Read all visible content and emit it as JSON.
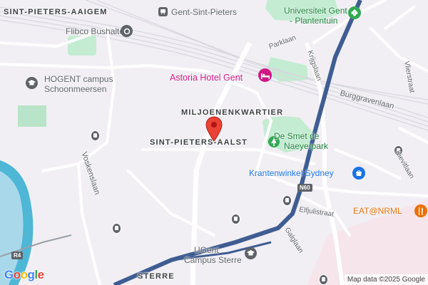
{
  "districts": {
    "sint_pieters_aaigem": "SINT-PIETERS-AAIGEM",
    "miljoenenkwartier": "MILJOENENKWARTIER",
    "sint_pieters_aalst": "SINT-PIETERS-AALST",
    "sterre": "STERRE"
  },
  "pois": {
    "gent_sint_pieters": "Gent-Sint-Pieters",
    "universiteit_line1": "Universiteit Gent",
    "universiteit_line2": "- Plantentuin",
    "flibco": "Flibco Bushalte",
    "hogent_line1": "HOGENT campus",
    "hogent_line2": "Schoonmeersen",
    "astoria": "Astoria Hotel Gent",
    "desmet_line1": "De Smet de",
    "desmet_line2": "Naeyerpark",
    "krantenwinkel": "Krantenwinkel Sydney",
    "eat": "EAT@NRML",
    "ugent_line1": "UGent",
    "ugent_line2": "Campus Sterre"
  },
  "roads": {
    "parklaan": "Parklaan",
    "krijgslaan": "Krijgslaan",
    "burggravenlaan": "Burggravenlaan",
    "vlierstraat": "Vlierstraat",
    "voskenslaan": "Voskenslaan",
    "kievitlaan": "Kievitlaan",
    "elfjulistraat": "Elfjulistraat",
    "galglaan": "Galglaan",
    "n60": "N60",
    "r4": "R4"
  },
  "attribution": "Map data ©2025 Google",
  "logo": "Google",
  "colors": {
    "land": "#f1eff4",
    "water": "#4eb7d6",
    "park": "#c3ecd2",
    "highway": "#3f5d92",
    "pin": "#ea4335"
  }
}
